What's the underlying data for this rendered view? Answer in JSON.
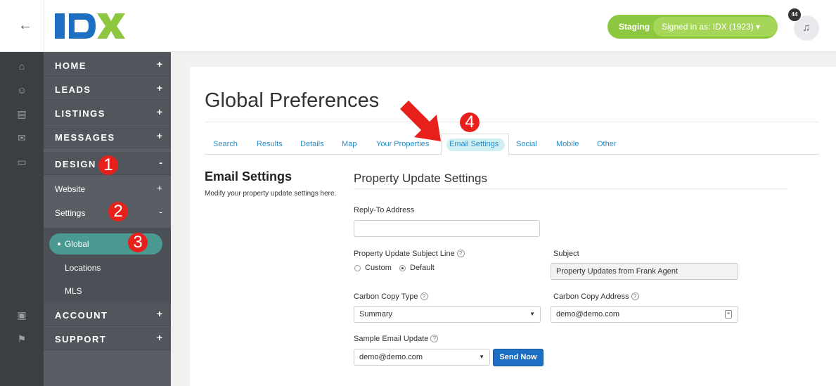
{
  "header": {
    "back_icon": "arrow-left-icon",
    "logo_text": "IDX",
    "environment": "Staging",
    "signed_in": "Signed in as: IDX (1923)",
    "notification_count": "44",
    "bell_icon": "bell-icon"
  },
  "rail": {
    "icons": [
      "home-icon",
      "user-icon",
      "listings-icon",
      "mail-icon",
      "monitor-icon",
      "archive-icon",
      "flag-icon"
    ]
  },
  "nav": {
    "items": [
      {
        "label": "HOME",
        "symbol": "+"
      },
      {
        "label": "LEADS",
        "symbol": "+"
      },
      {
        "label": "LISTINGS",
        "symbol": "+"
      },
      {
        "label": "MESSAGES",
        "symbol": "+"
      },
      {
        "label": "DESIGN",
        "symbol": "-"
      }
    ],
    "design_sub": [
      {
        "label": "Website",
        "symbol": "+"
      },
      {
        "label": "Settings",
        "symbol": "-"
      }
    ],
    "settings_sub": [
      "Global",
      "Locations",
      "MLS"
    ],
    "bottom_items": [
      {
        "label": "ACCOUNT",
        "symbol": "+"
      },
      {
        "label": "SUPPORT",
        "symbol": "+"
      }
    ]
  },
  "callouts": [
    "1",
    "2",
    "3",
    "4"
  ],
  "page": {
    "title": "Global Preferences",
    "tabs": [
      "Search",
      "Results",
      "Details",
      "Map",
      "Your Properties",
      "Email Settings",
      "Social",
      "Mobile",
      "Other"
    ],
    "active_tab": "Email Settings"
  },
  "section": {
    "title": "Email Settings",
    "description": "Modify your property update settings here.",
    "subtitle": "Property Update Settings"
  },
  "form": {
    "reply_to_label": "Reply-To Address",
    "reply_to_value": "",
    "subject_line_label": "Property Update Subject Line",
    "radio_custom": "Custom",
    "radio_default": "Default",
    "subject_label": "Subject",
    "subject_value": "Property Updates from Frank Agent",
    "cc_type_label": "Carbon Copy Type",
    "cc_type_value": "Summary",
    "cc_address_label": "Carbon Copy Address",
    "cc_address_value": "demo@demo.com",
    "sample_label": "Sample Email Update",
    "sample_value": "demo@demo.com",
    "send_button": "Send Now",
    "help_glyph": "?"
  },
  "colors": {
    "brand_green": "#8dc63f",
    "logo_blue": "#1c6fc2",
    "callout_red": "#e8201c",
    "link_blue": "#2a8cc4"
  }
}
